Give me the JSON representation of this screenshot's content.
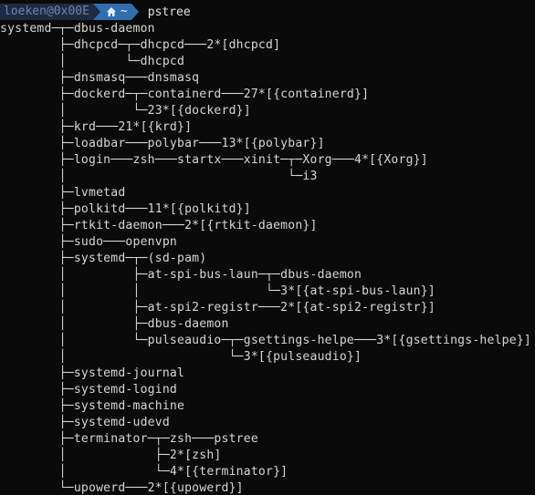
{
  "prompt": {
    "user_host": "loeken@0x00E",
    "directory": "~",
    "command": "pstree"
  },
  "tree_lines": [
    "systemd─┬─dbus-daemon",
    "        ├─dhcpcd─┬─dhcpcd───2*[dhcpcd]",
    "        │        └─dhcpcd",
    "        ├─dnsmasq───dnsmasq",
    "        ├─dockerd─┬─containerd───27*[{containerd}]",
    "        │         └─23*[{dockerd}]",
    "        ├─krd───21*[{krd}]",
    "        ├─loadbar───polybar───13*[{polybar}]",
    "        ├─login───zsh───startx───xinit─┬─Xorg───4*[{Xorg}]",
    "        │                              └─i3",
    "        ├─lvmetad",
    "        ├─polkitd───11*[{polkitd}]",
    "        ├─rtkit-daemon───2*[{rtkit-daemon}]",
    "        ├─sudo───openvpn",
    "        ├─systemd─┬─(sd-pam)",
    "        │         ├─at-spi-bus-laun─┬─dbus-daemon",
    "        │         │                 └─3*[{at-spi-bus-laun}]",
    "        │         ├─at-spi2-registr───2*[{at-spi2-registr}]",
    "        │         ├─dbus-daemon",
    "        │         └─pulseaudio─┬─gsettings-helpe───3*[{gsettings-helpe}]",
    "        │                      └─3*[{pulseaudio}]",
    "        ├─systemd-journal",
    "        ├─systemd-logind",
    "        ├─systemd-machine",
    "        ├─systemd-udevd",
    "        ├─terminator─┬─zsh───pstree",
    "        │            ├─2*[zsh]",
    "        │            └─4*[{terminator}]",
    "        └─upowerd───2*[{upowerd}]"
  ],
  "colors": {
    "background": "#0a0a0a",
    "text": "#d6d6d6",
    "prompt_user_bg": "#1e2a40",
    "prompt_dir_bg": "#2f6fb0"
  },
  "icons": {
    "directory": "home-icon"
  }
}
